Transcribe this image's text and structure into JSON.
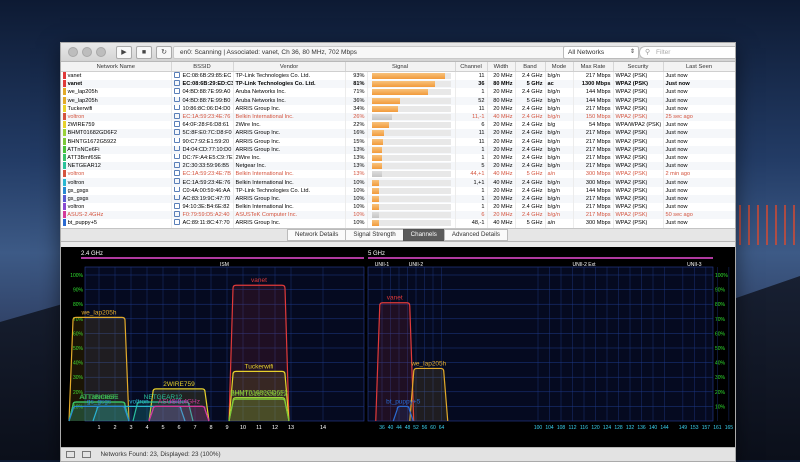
{
  "toolbar": {
    "status_text": "en0: Scanning  |  Associated: vanet, Ch 36, 80 MHz, 702 Mbps",
    "network_filter_select": "All Networks",
    "filter_placeholder": "Filter"
  },
  "table": {
    "headers": [
      "Network Name",
      "BSSID",
      "Vendor",
      "Signal",
      "Channel",
      "Width",
      "Band",
      "Mode",
      "Max Rate",
      "Security",
      "Last Seen"
    ],
    "rows": [
      {
        "color": "#e03a3a",
        "name": "vanet",
        "bssid": "EC:08:6B:29:85:EC",
        "vendor": "TP-Link Technologies Co. Ltd.",
        "pct": "93%",
        "sig": 93,
        "channel": "11",
        "width": "20 MHz",
        "band": "2.4 GHz",
        "mode": "b/g/n",
        "rate": "217 Mbps",
        "security": "WPA2 (PSK)",
        "seen": "Just now",
        "style": ""
      },
      {
        "color": "#e03a3a",
        "name": "vanet",
        "bssid": "EC:08:6B:29:ED:C3",
        "vendor": "TP-Link Technologies Co. Ltd.",
        "pct": "81%",
        "sig": 81,
        "channel": "36",
        "width": "80 MHz",
        "band": "5 GHz",
        "mode": "ac",
        "rate": "1300 Mbps",
        "security": "WPA2 (PSK)",
        "seen": "Just now",
        "style": "bold"
      },
      {
        "color": "#e2aa2a",
        "name": "we_lap205h",
        "bssid": "04:BD:88:7E:99:A0",
        "vendor": "Aruba Networks Inc.",
        "pct": "71%",
        "sig": 71,
        "channel": "1",
        "width": "20 MHz",
        "band": "2.4 GHz",
        "mode": "b/g/n",
        "rate": "144 Mbps",
        "security": "WPA2 (PSK)",
        "seen": "Just now",
        "style": ""
      },
      {
        "color": "#e2aa2a",
        "name": "we_lap205h",
        "bssid": "04:BD:88:7E:99:B0",
        "vendor": "Aruba Networks Inc.",
        "pct": "36%",
        "sig": 36,
        "channel": "52",
        "width": "80 MHz",
        "band": "5 GHz",
        "mode": "b/g/n",
        "rate": "144 Mbps",
        "security": "WPA2 (PSK)",
        "seen": "Just now",
        "style": ""
      },
      {
        "color": "#e8d22c",
        "name": "Tuckerwifi",
        "bssid": "10:86:8C:06:D4:D0",
        "vendor": "ARRIS Group Inc.",
        "pct": "34%",
        "sig": 34,
        "channel": "11",
        "width": "20 MHz",
        "band": "2.4 GHz",
        "mode": "b/g/n",
        "rate": "217 Mbps",
        "security": "WPA2 (PSK)",
        "seen": "Just now",
        "style": ""
      },
      {
        "color": "#d4543e",
        "name": "voltron",
        "bssid": "EC:1A:59:23:4E:76",
        "vendor": "Belkin International Inc.",
        "pct": "26%",
        "sig": 26,
        "channel": "11,-1",
        "width": "40 MHz",
        "band": "2.4 GHz",
        "mode": "b/g/n",
        "rate": "150 Mbps",
        "security": "WPA2 (PSK)",
        "seen": "25 sec ago",
        "style": "stale"
      },
      {
        "color": "#e8d22c",
        "name": "2WIRE759",
        "bssid": "64:0F:28:F6:D8:61",
        "vendor": "2Wire Inc.",
        "pct": "22%",
        "sig": 22,
        "channel": "6",
        "width": "20 MHz",
        "band": "2.4 GHz",
        "mode": "b/g",
        "rate": "54 Mbps",
        "security": "WPA/WPA2 (PSK)",
        "seen": "Just now",
        "style": ""
      },
      {
        "color": "#9ad23a",
        "name": "BHMT01682GD6F2",
        "bssid": "5C:8F:E0:7C:D8:F0",
        "vendor": "ARRIS Group Inc.",
        "pct": "16%",
        "sig": 16,
        "channel": "11",
        "width": "20 MHz",
        "band": "2.4 GHz",
        "mode": "b/g/n",
        "rate": "217 Mbps",
        "security": "WPA2 (PSK)",
        "seen": "Just now",
        "style": ""
      },
      {
        "color": "#7cc83a",
        "name": "BHNTG1672G5922",
        "bssid": "90:C7:92:E1:59:20",
        "vendor": "ARRIS Group Inc.",
        "pct": "15%",
        "sig": 15,
        "channel": "11",
        "width": "20 MHz",
        "band": "2.4 GHz",
        "mode": "b/g/n",
        "rate": "217 Mbps",
        "security": "WPA2 (PSK)",
        "seen": "Just now",
        "style": ""
      },
      {
        "color": "#4ac23a",
        "name": "ATTnNCe6Fi",
        "bssid": "D4:04:CD:77:10:D0",
        "vendor": "ARRIS Group Inc.",
        "pct": "13%",
        "sig": 13,
        "channel": "1",
        "width": "20 MHz",
        "band": "2.4 GHz",
        "mode": "b/g/n",
        "rate": "217 Mbps",
        "security": "WPA2 (PSK)",
        "seen": "Just now",
        "style": ""
      },
      {
        "color": "#3ac26a",
        "name": "ATT3Bmf6SE",
        "bssid": "DC:7F:A4:E5:C9:7E",
        "vendor": "2Wire Inc.",
        "pct": "13%",
        "sig": 13,
        "channel": "1",
        "width": "20 MHz",
        "band": "2.4 GHz",
        "mode": "b/g/n",
        "rate": "217 Mbps",
        "security": "WPA2 (PSK)",
        "seen": "Just now",
        "style": ""
      },
      {
        "color": "#2ac29a",
        "name": "NETGEAR12",
        "bssid": "2C:30:33:59:96:B5",
        "vendor": "Netgear Inc.",
        "pct": "13%",
        "sig": 13,
        "channel": "5",
        "width": "20 MHz",
        "band": "2.4 GHz",
        "mode": "b/g/n",
        "rate": "217 Mbps",
        "security": "WPA2 (PSK)",
        "seen": "Just now",
        "style": ""
      },
      {
        "color": "#d4543e",
        "name": "voltron",
        "bssid": "EC:1A:59:23:4E:7B",
        "vendor": "Belkin International Inc.",
        "pct": "13%",
        "sig": 13,
        "channel": "44,+1",
        "width": "40 MHz",
        "band": "5 GHz",
        "mode": "a/n",
        "rate": "300 Mbps",
        "security": "WPA2 (PSK)",
        "seen": "2 min ago",
        "style": "stale"
      },
      {
        "color": "#2ab8d2",
        "name": "voltron",
        "bssid": "EC:1A:59:23:4E:76",
        "vendor": "Belkin International Inc.",
        "pct": "10%",
        "sig": 10,
        "channel": "1,+1",
        "width": "40 MHz",
        "band": "2.4 GHz",
        "mode": "b/g/n",
        "rate": "300 Mbps",
        "security": "WPA2 (PSK)",
        "seen": "Just now",
        "style": ""
      },
      {
        "color": "#2a8ad2",
        "name": "gs_gsgs",
        "bssid": "C0:4A:00:59:46:AA",
        "vendor": "TP-Link Technologies Co. Ltd.",
        "pct": "10%",
        "sig": 10,
        "channel": "1",
        "width": "20 MHz",
        "band": "2.4 GHz",
        "mode": "b/g/n",
        "rate": "144 Mbps",
        "security": "WPA2 (PSK)",
        "seen": "Just now",
        "style": ""
      },
      {
        "color": "#5a5ad2",
        "name": "gs_gsgs",
        "bssid": "AC:83:19:9C:47:70",
        "vendor": "ARRIS Group Inc.",
        "pct": "10%",
        "sig": 10,
        "channel": "1",
        "width": "20 MHz",
        "band": "2.4 GHz",
        "mode": "b/g/n",
        "rate": "217 Mbps",
        "security": "WPA2 (PSK)",
        "seen": "Just now",
        "style": ""
      },
      {
        "color": "#8a4ad2",
        "name": "voltron",
        "bssid": "94:10:3E:B4:6E:82",
        "vendor": "Belkin International Inc.",
        "pct": "10%",
        "sig": 10,
        "channel": "1",
        "width": "20 MHz",
        "band": "2.4 GHz",
        "mode": "b/g/n",
        "rate": "217 Mbps",
        "security": "WPA2 (PSK)",
        "seen": "Just now",
        "style": ""
      },
      {
        "color": "#d43a9a",
        "name": "ASUS-2.4GHz",
        "bssid": "F0:79:59:D5:A2:40",
        "vendor": "ASUSTeK Computer Inc.",
        "pct": "10%",
        "sig": 10,
        "channel": "6",
        "width": "20 MHz",
        "band": "2.4 GHz",
        "mode": "b/g/n",
        "rate": "217 Mbps",
        "security": "WPA2 (PSK)",
        "seen": "50 sec ago",
        "style": "stale"
      },
      {
        "color": "#2a6ad2",
        "name": "bt_puppy+5",
        "bssid": "AC:89:11:8C:47:70",
        "vendor": "ARRIS Group Inc.",
        "pct": "10%",
        "sig": 10,
        "channel": "48,-1",
        "width": "40 MHz",
        "band": "5 GHz",
        "mode": "a/n",
        "rate": "300 Mbps",
        "security": "WPA2 (PSK)",
        "seen": "Just now",
        "style": ""
      }
    ]
  },
  "tabs": [
    {
      "label": "Network Details",
      "active": false
    },
    {
      "label": "Signal Strength",
      "active": false
    },
    {
      "label": "Channels",
      "active": true
    },
    {
      "label": "Advanced Details",
      "active": false
    }
  ],
  "chart": {
    "band24_label": "2.4 GHz",
    "band5_label": "5 GHz",
    "sub24": "ISM",
    "sub5": [
      "UNII-1",
      "UNII-2",
      "UNII-2 Ext",
      "UNII-3"
    ],
    "percent_ticks": [
      "100%",
      "90%",
      "80%",
      "70%",
      "60%",
      "50%",
      "40%",
      "30%",
      "20%",
      "10%"
    ],
    "ch24_ticks": [
      "1",
      "2",
      "3",
      "4",
      "5",
      "6",
      "7",
      "8",
      "9",
      "10",
      "11",
      "12",
      "13",
      "14"
    ],
    "ch5_ticks": [
      "36",
      "40",
      "44",
      "48",
      "52",
      "56",
      "60",
      "64",
      "100",
      "104",
      "108",
      "112",
      "116",
      "120",
      "124",
      "128",
      "132",
      "136",
      "140",
      "144",
      "149",
      "153",
      "157",
      "161",
      "165"
    ],
    "networks24": [
      {
        "label": "vanet",
        "color": "#e03a3a",
        "center": 11,
        "width": 20,
        "pct": 93
      },
      {
        "label": "we_lap205h",
        "color": "#e2aa2a",
        "center": 1,
        "width": 20,
        "pct": 71
      },
      {
        "label": "Tuckerwifi",
        "color": "#e8d22c",
        "center": 11,
        "width": 20,
        "pct": 34
      },
      {
        "label": "2WIRE759",
        "color": "#e8d22c",
        "center": 6,
        "width": 20,
        "pct": 22
      },
      {
        "label": "BHMT01682GD6F2",
        "color": "#9ad23a",
        "center": 11,
        "width": 20,
        "pct": 16
      },
      {
        "label": "BHNTG1672G5922",
        "color": "#7cc83a",
        "center": 11,
        "width": 20,
        "pct": 15
      },
      {
        "label": "ATTnNCe6Fi",
        "color": "#4ac23a",
        "center": 1,
        "width": 20,
        "pct": 13
      },
      {
        "label": "ATT3Bmf6SE",
        "color": "#3ac26a",
        "center": 1,
        "width": 20,
        "pct": 13
      },
      {
        "label": "NETGEAR12",
        "color": "#2ac29a",
        "center": 5,
        "width": 20,
        "pct": 13
      },
      {
        "label": "voltron",
        "color": "#2ab8d2",
        "center": 3,
        "width": 40,
        "pct": 10
      },
      {
        "label": "gs_gsgs",
        "color": "#2a8ad2",
        "center": 1,
        "width": 20,
        "pct": 10
      },
      {
        "label": "voltron",
        "color": "#8a4ad2",
        "center": 6,
        "width": 20,
        "pct": 10
      },
      {
        "label": "ASUS-2.4GHz",
        "color": "#d43a9a",
        "center": 6,
        "width": 20,
        "pct": 10
      }
    ],
    "networks5": [
      {
        "label": "vanet",
        "color": "#e03a3a",
        "center": 42,
        "width": 80,
        "pct": 81
      },
      {
        "label": "we_lap205h",
        "color": "#e2aa2a",
        "center": 58,
        "width": 80,
        "pct": 36
      },
      {
        "label": "bt_puppy+5",
        "color": "#2a6ad2",
        "center": 46,
        "width": 40,
        "pct": 10
      }
    ]
  },
  "status_bar": {
    "text": "Networks Found: 23, Displayed: 23 (100%)"
  },
  "colors": {
    "grid": "#1e3a8a",
    "axis_green": "#2fe02f",
    "ch24_green": "#ffffff",
    "ch5_cyan": "#3ad2f0",
    "band_bar": "#b03aa0"
  }
}
